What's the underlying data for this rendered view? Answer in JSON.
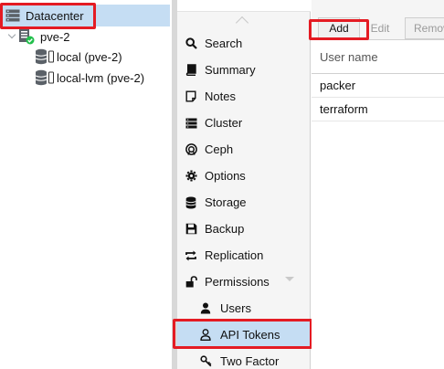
{
  "tree": {
    "datacenter": {
      "label": "Datacenter",
      "icon": "server-stack-icon"
    },
    "node": {
      "label": "pve-2",
      "icon": "node-online-icon"
    },
    "storages": [
      {
        "label": "local (pve-2)",
        "icon": "storage-icon"
      },
      {
        "label": "local-lvm (pve-2)",
        "icon": "storage-icon"
      }
    ]
  },
  "nav": {
    "items": [
      {
        "label": "Search",
        "icon": "search-icon"
      },
      {
        "label": "Summary",
        "icon": "book-icon"
      },
      {
        "label": "Notes",
        "icon": "notes-icon"
      },
      {
        "label": "Cluster",
        "icon": "cluster-icon"
      },
      {
        "label": "Ceph",
        "icon": "ceph-icon"
      },
      {
        "label": "Options",
        "icon": "gear-icon"
      },
      {
        "label": "Storage",
        "icon": "database-icon"
      },
      {
        "label": "Backup",
        "icon": "floppy-icon"
      },
      {
        "label": "Replication",
        "icon": "replication-icon"
      },
      {
        "label": "Permissions",
        "icon": "unlock-icon"
      },
      {
        "label": "Users",
        "icon": "user-icon"
      },
      {
        "label": "API Tokens",
        "icon": "user-outline-icon"
      },
      {
        "label": "Two Factor",
        "icon": "key-icon"
      }
    ]
  },
  "toolbar": {
    "add": "Add",
    "edit": "Edit",
    "remove": "Remove"
  },
  "grid": {
    "header": "User name",
    "rows": [
      "packer",
      "terraform"
    ]
  },
  "colors": {
    "selection": "#c5ddf3",
    "highlight": "#e41b23",
    "online": "#21bf4b"
  }
}
